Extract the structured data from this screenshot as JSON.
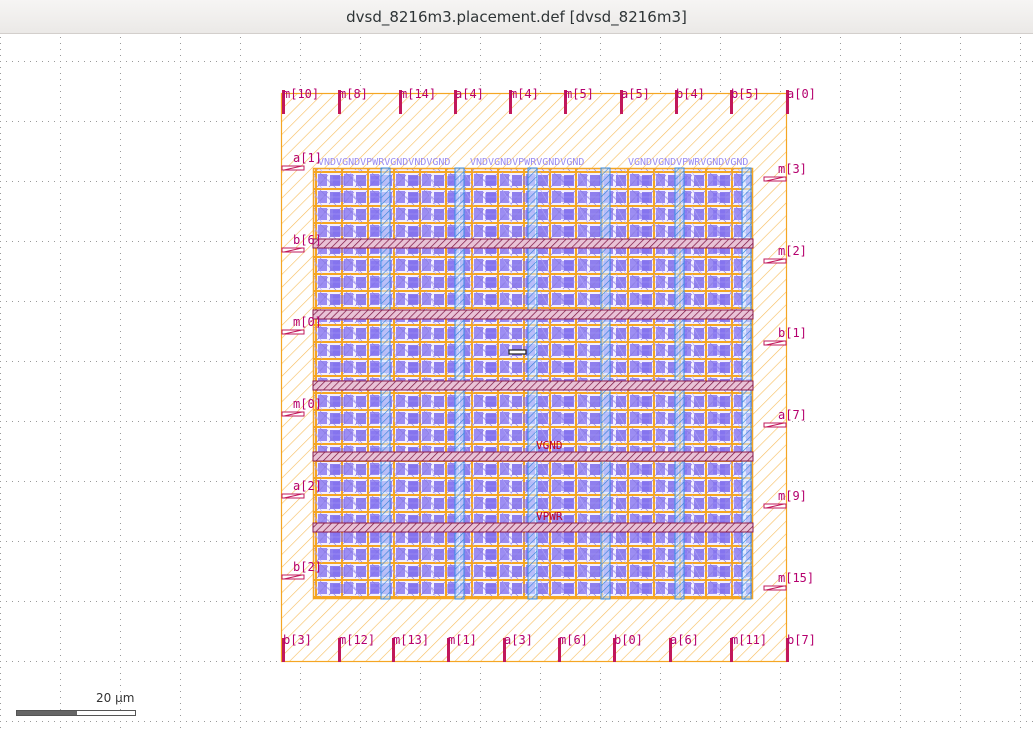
{
  "window": {
    "title": "dvsd_8216m3.placement.def [dvsd_8216m3]"
  },
  "scale_bar": {
    "label": "20 µm"
  },
  "pins": {
    "top": [
      "m[10]",
      "m[8]",
      "m[14]",
      "a[4]",
      "m[4]",
      "m[5]",
      "a[5]",
      "b[4]",
      "b[5]",
      "a[0]"
    ],
    "bottom": [
      "b[3]",
      "m[12]",
      "m[13]",
      "m[1]",
      "a[3]",
      "m[6]",
      "b[0]",
      "a[6]",
      "m[11]",
      "b[7]"
    ],
    "left": [
      "a[1]",
      "b[6]",
      "m[0]",
      "m[0]",
      "a[2]",
      "b[2]"
    ],
    "right": [
      "m[3]",
      "m[2]",
      "b[1]",
      "a[7]",
      "m[9]",
      "m[15]"
    ]
  },
  "nets": {
    "ground": "VGND",
    "power": "VPWR"
  },
  "colors": {
    "die_outline": "#f5a623",
    "pin": "#c2185b",
    "cell": "#9b8cf2",
    "power_strap_vertical": "#3a8ee6",
    "power_rail_horizontal": "#8b1a4a",
    "grid_dot": "#9a9a9a"
  }
}
